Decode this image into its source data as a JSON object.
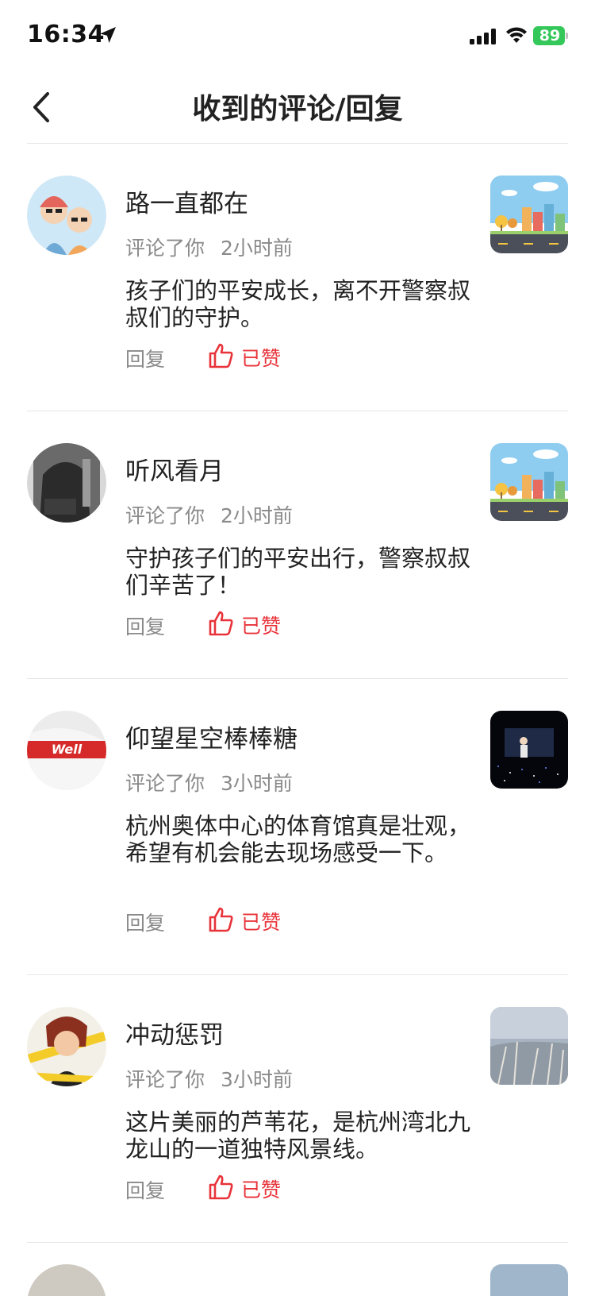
{
  "status_bar": {
    "time": "16:34",
    "battery": "89"
  },
  "header": {
    "title": "收到的评论/回复"
  },
  "comments": [
    {
      "user": "路一直都在",
      "action": "评论了你",
      "time": "2小时前",
      "content": "孩子们的平安成长，离不开警察叔叔们的守护。",
      "reply_label": "回复",
      "liked_label": "已赞"
    },
    {
      "user": "听风看月",
      "action": "评论了你",
      "time": "2小时前",
      "content": "守护孩子们的平安出行，警察叔叔们辛苦了！",
      "reply_label": "回复",
      "liked_label": "已赞"
    },
    {
      "user": "仰望星空棒棒糖",
      "action": "评论了你",
      "time": "3小时前",
      "content": "杭州奥体中心的体育馆真是壮观，希望有机会能去现场感受一下。",
      "reply_label": "回复",
      "liked_label": "已赞"
    },
    {
      "user": "冲动惩罚",
      "action": "评论了你",
      "time": "3小时前",
      "content": "这片美丽的芦苇花，是杭州湾北九龙山的一道独特风景线。",
      "reply_label": "回复",
      "liked_label": "已赞"
    }
  ],
  "colors": {
    "accent": "#e8333a",
    "muted": "#8a8a8a",
    "battery": "#34c759"
  }
}
